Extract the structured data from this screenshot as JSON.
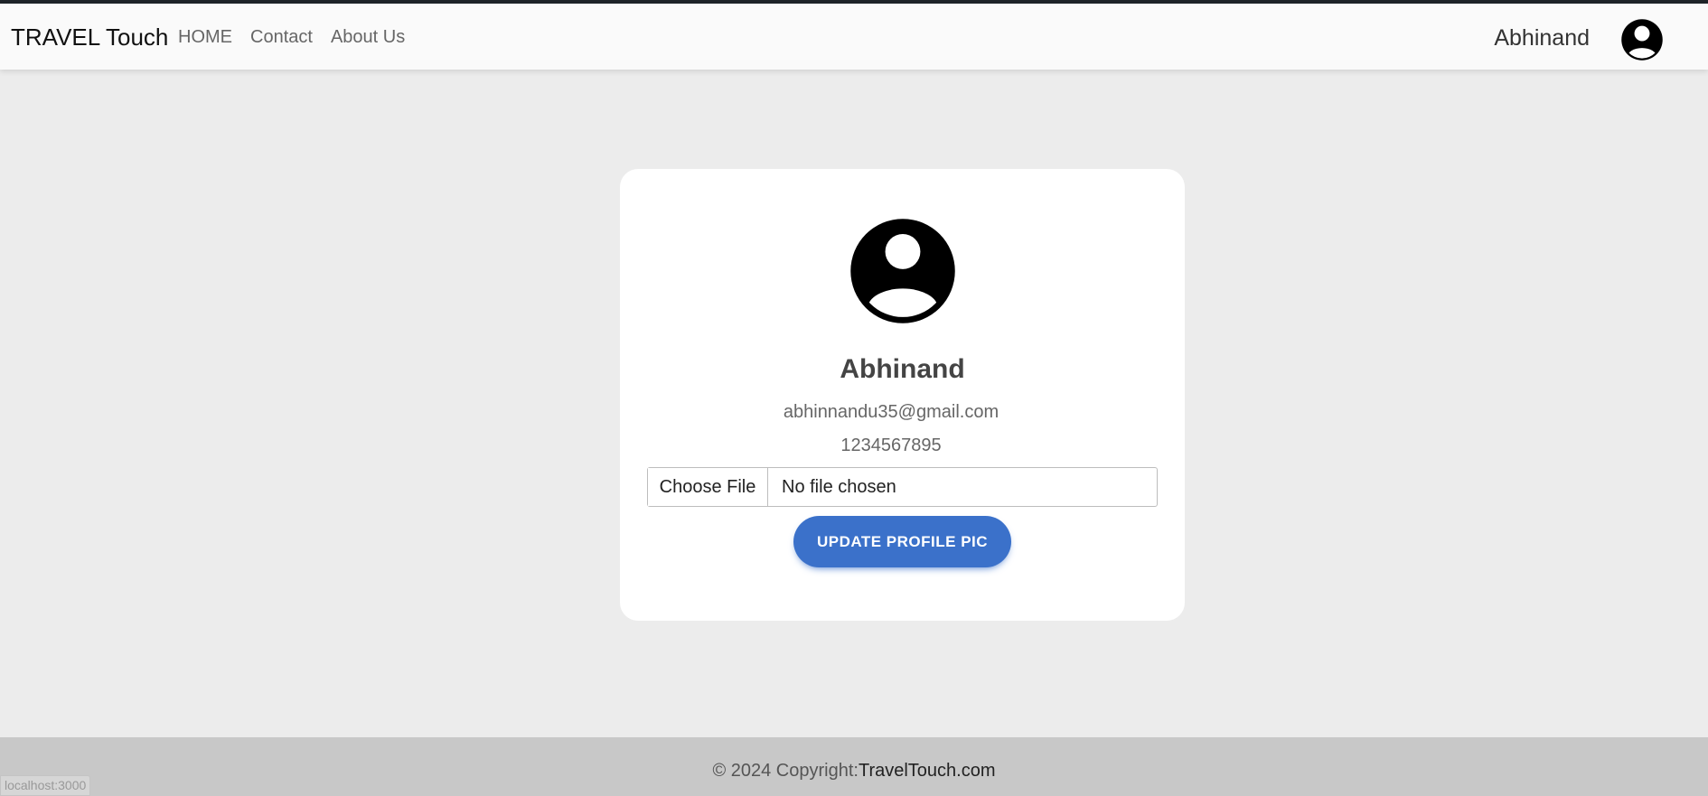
{
  "navbar": {
    "brand": "TRAVEL Touch",
    "links": [
      "HOME",
      "Contact",
      "About Us"
    ],
    "username": "Abhinand",
    "avatar_icon": "account-circle-icon"
  },
  "profile": {
    "avatar_icon": "account-circle-icon",
    "name": "Abhinand",
    "email": "abhinnandu35@gmail.com",
    "phone": "1234567895",
    "file_button_label": "Choose File",
    "file_status": "No file chosen",
    "update_button_label": "UPDATE PROFILE PIC"
  },
  "footer": {
    "copyright": "© 2024 Copyright:",
    "link": "TravelTouch.com"
  },
  "status_bar": {
    "url": "localhost:3000"
  },
  "colors": {
    "primary_button": "#3b71ca",
    "page_background": "#ececec",
    "footer_background": "#c8c8c8"
  }
}
